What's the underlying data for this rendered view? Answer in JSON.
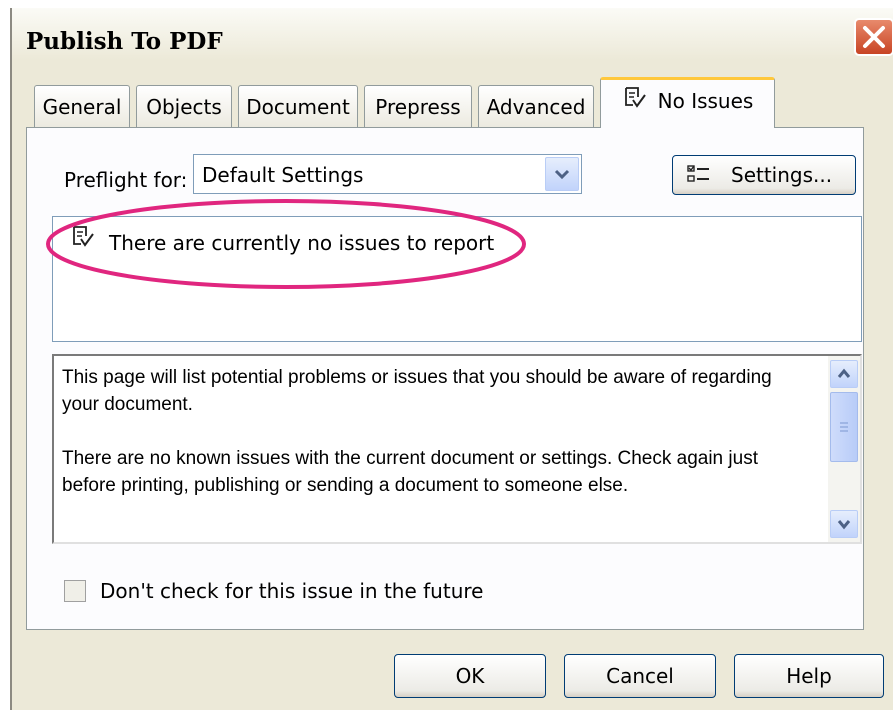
{
  "window": {
    "title": "Publish To PDF"
  },
  "tabs": [
    {
      "label": "General",
      "active": false
    },
    {
      "label": "Objects",
      "active": false
    },
    {
      "label": "Document",
      "active": false
    },
    {
      "label": "Prepress",
      "active": false
    },
    {
      "label": "Advanced",
      "active": false
    },
    {
      "label": "No Issues",
      "active": true,
      "icon": "preflight-check-icon"
    }
  ],
  "preflight": {
    "label": "Preflight for:",
    "selected": "Default Settings",
    "settings_button": "Settings...",
    "settings_icon": "checklist-icon"
  },
  "issues": {
    "message": "There are currently no issues to report",
    "icon": "preflight-check-icon",
    "highlight_color": "#e0267f"
  },
  "description": {
    "paragraph1": "This page will list potential problems or issues that you should be aware of regarding your document.",
    "paragraph2": "There are no known issues with the current document or settings. Check again just before printing, publishing or sending a document to someone else."
  },
  "checkbox": {
    "label": "Don't check for this issue in the future",
    "checked": false
  },
  "buttons": {
    "ok": "OK",
    "cancel": "Cancel",
    "help": "Help"
  }
}
